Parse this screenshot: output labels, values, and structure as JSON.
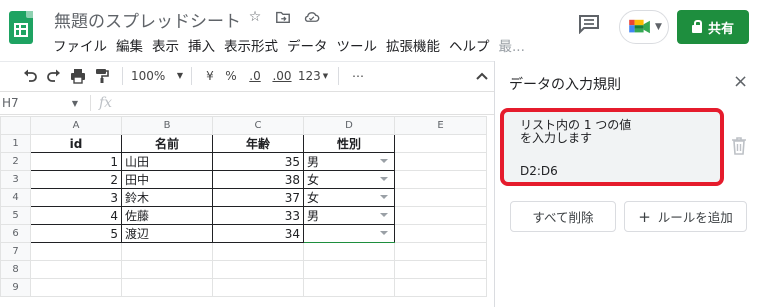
{
  "header": {
    "doc_title": "無題のスプレッドシート",
    "star_icon": "☆",
    "move_icon": "⇥",
    "cloud_icon": "☁",
    "menu": [
      "ファイル",
      "編集",
      "表示",
      "挿入",
      "表示形式",
      "データ",
      "ツール",
      "拡張機能",
      "ヘルプ"
    ],
    "menu_more": "最...",
    "share_label": "共有"
  },
  "toolbar": {
    "zoom": "100%",
    "currency": "¥",
    "percent": "%",
    "decrease_decimal": ".0",
    "increase_decimal": ".00",
    "more_formats": "123",
    "more": "⋯",
    "collapse": "^"
  },
  "formula_bar": {
    "name_box": "H7",
    "fx_label": "fx"
  },
  "sheet": {
    "columns": [
      "A",
      "B",
      "C",
      "D",
      "E"
    ],
    "row_numbers": [
      "1",
      "2",
      "3",
      "4",
      "5",
      "6",
      "7",
      "8",
      "9"
    ],
    "headers": [
      "id",
      "名前",
      "年齢",
      "性別"
    ],
    "rows": [
      {
        "id": "1",
        "name": "山田",
        "age": "35",
        "gender": "男"
      },
      {
        "id": "2",
        "name": "田中",
        "age": "38",
        "gender": "女"
      },
      {
        "id": "3",
        "name": "鈴木",
        "age": "37",
        "gender": "女"
      },
      {
        "id": "4",
        "name": "佐藤",
        "age": "33",
        "gender": "男"
      },
      {
        "id": "5",
        "name": "渡辺",
        "age": "34",
        "gender": ""
      }
    ]
  },
  "panel": {
    "title": "データの入力規則",
    "close_icon": "×",
    "rule_line1": "リスト内の 1 つの値",
    "rule_line2": "を入力します",
    "rule_range": "D2:D6",
    "clear_all": "すべて削除",
    "add_rule": "ルールを追加",
    "add_icon": "+"
  },
  "colors": {
    "brand_green": "#1e8e3e",
    "highlight_red": "#e51b2c",
    "sheets_logo": "#1ea362"
  },
  "icons": [
    "sheets-logo-icon",
    "star-icon",
    "move-to-folder-icon",
    "cloud-status-icon",
    "comment-icon",
    "meet-icon",
    "lock-icon",
    "undo-icon",
    "redo-icon",
    "print-icon",
    "paint-format-icon",
    "trash-icon",
    "close-icon",
    "plus-icon"
  ]
}
